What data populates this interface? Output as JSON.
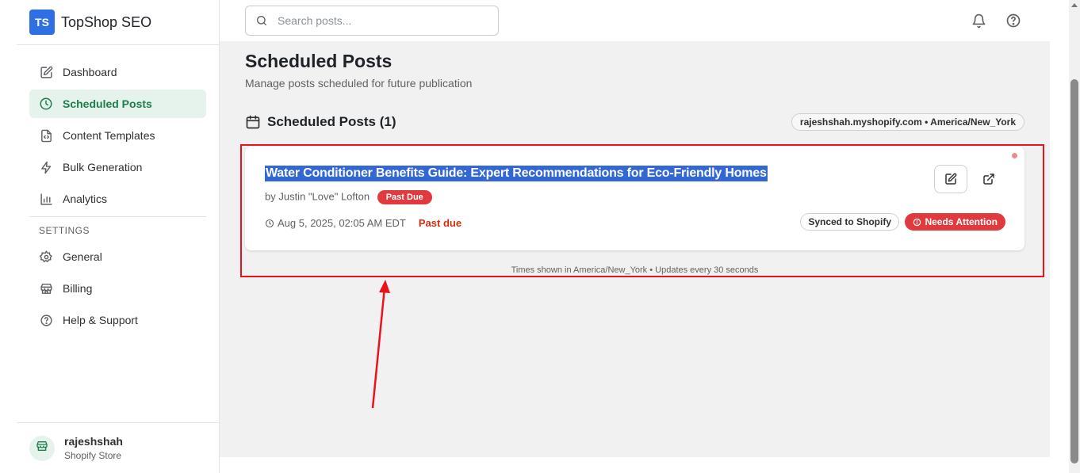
{
  "brand": {
    "logo_text": "TS",
    "name": "TopShop SEO"
  },
  "sidebar": {
    "items": [
      {
        "label": "Dashboard",
        "icon": "edit-square-icon"
      },
      {
        "label": "Scheduled Posts",
        "icon": "clock-icon",
        "active": true
      },
      {
        "label": "Content Templates",
        "icon": "file-code-icon"
      },
      {
        "label": "Bulk Generation",
        "icon": "lightning-icon"
      },
      {
        "label": "Analytics",
        "icon": "bar-chart-icon"
      }
    ],
    "settings_heading": "SETTINGS",
    "settings_items": [
      {
        "label": "General",
        "icon": "gear-icon"
      },
      {
        "label": "Billing",
        "icon": "store-icon"
      },
      {
        "label": "Help & Support",
        "icon": "help-circle-icon"
      }
    ],
    "user": {
      "name": "rajeshshah",
      "subtitle": "Shopify Store"
    }
  },
  "search": {
    "placeholder": "Search posts..."
  },
  "page": {
    "title": "Scheduled Posts",
    "subtitle": "Manage posts scheduled for future publication",
    "section_title": "Scheduled Posts (1)",
    "store_info": "rajeshshah.myshopify.com • America/New_York"
  },
  "post": {
    "title": "Water Conditioner Benefits Guide: Expert Recommendations for Eco-Friendly Homes",
    "author": "by Justin \"Love\" Lofton",
    "status_badge": "Past Due",
    "datetime": "Aug 5, 2025, 02:05 AM EDT",
    "due_text": "Past due",
    "sync_chip": "Synced to Shopify",
    "attention_chip": "Needs Attention"
  },
  "footer_note": "Times shown in America/New_York • Updates every 30 seconds",
  "colors": {
    "accent_green": "#1a7f4b",
    "danger_red": "#e0393e",
    "brand_blue": "#2f6fe4",
    "annotation_red": "#e8131b"
  }
}
